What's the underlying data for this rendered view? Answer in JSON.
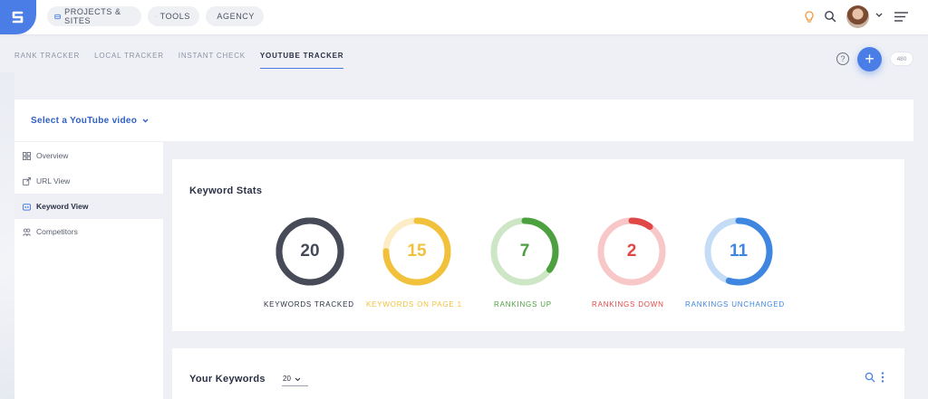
{
  "topbar": {
    "nav": [
      {
        "label": "PROJECTS & SITES",
        "icon": "projects-icon"
      },
      {
        "label": "TOOLS",
        "icon": "tools-icon"
      },
      {
        "label": "AGENCY",
        "icon": "agency-icon"
      }
    ],
    "icons": [
      "bulb-icon",
      "search-icon",
      "avatar",
      "chevron-down-icon",
      "menu-icon"
    ]
  },
  "tabs": [
    {
      "label": "RANK TRACKER",
      "active": false
    },
    {
      "label": "LOCAL TRACKER",
      "active": false
    },
    {
      "label": "INSTANT CHECK",
      "active": false
    },
    {
      "label": "YOUTUBE TRACKER",
      "active": true
    }
  ],
  "actions": {
    "help": "?",
    "add": "+",
    "count": "480"
  },
  "video_select": {
    "label": "Select a YouTube video"
  },
  "sidebar": {
    "items": [
      {
        "label": "Overview",
        "icon": "grid-icon",
        "active": false
      },
      {
        "label": "URL View",
        "icon": "link-icon",
        "active": false
      },
      {
        "label": "Keyword View",
        "icon": "keyword-icon",
        "active": true
      },
      {
        "label": "Competitors",
        "icon": "users-icon",
        "active": false
      }
    ]
  },
  "keyword_stats": {
    "title": "Keyword Stats",
    "gauges": [
      {
        "value": "20",
        "label": "KEYWORDS TRACKED",
        "fraction": 1.0,
        "color": "#474a57",
        "track": "#474a57"
      },
      {
        "value": "15",
        "label": "KEYWORDS ON PAGE 1",
        "fraction": 0.75,
        "color": "#f1c13b",
        "track": "#fdedc6"
      },
      {
        "value": "7",
        "label": "RANKINGS UP",
        "fraction": 0.35,
        "color": "#4da040",
        "track": "#cce6c6"
      },
      {
        "value": "2",
        "label": "RANKINGS DOWN",
        "fraction": 0.1,
        "color": "#e04848",
        "track": "#f8c7c7"
      },
      {
        "value": "11",
        "label": "RANKINGS UNCHANGED",
        "fraction": 0.55,
        "color": "#3f86e0",
        "track": "#c5dcf6"
      }
    ]
  },
  "your_keywords": {
    "title": "Your Keywords",
    "page_size": "20"
  }
}
